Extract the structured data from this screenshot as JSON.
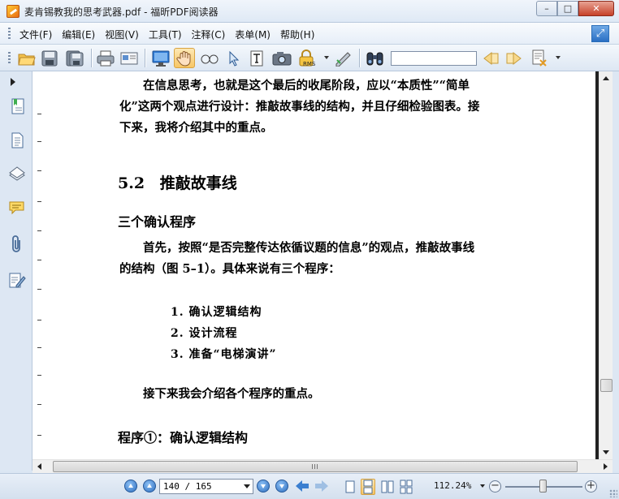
{
  "window": {
    "title": "麦肯锡教我的思考武器.pdf - 福昕PDF阅读器",
    "minimize_glyph": "–",
    "maximize_glyph": "□",
    "close_glyph": "✕"
  },
  "menu": {
    "items": [
      {
        "label": "文件(F)"
      },
      {
        "label": "编辑(E)"
      },
      {
        "label": "视图(V)"
      },
      {
        "label": "工具(T)"
      },
      {
        "label": "注释(C)"
      },
      {
        "label": "表单(M)"
      },
      {
        "label": "帮助(H)"
      }
    ]
  },
  "toolbar": {
    "search_value": "",
    "icons": [
      "open-folder-icon",
      "save-icon",
      "save-as-icon",
      "print-icon",
      "email-icon",
      "fullscreen-icon",
      "hand-tool-icon",
      "zoom-tool-icon",
      "select-arrow-icon",
      "text-select-icon",
      "snapshot-icon",
      "rms-lock-icon",
      "typewriter-icon",
      "binoculars-icon",
      "prev-result-icon",
      "next-result-icon",
      "highlight-icon"
    ],
    "rms_label": "RMS"
  },
  "document": {
    "para1": "在信息思考，也就是这个最后的收尾阶段，应以“本质性”“简单",
    "para1_line2": "化”这两个观点进行设计：推敲故事线的结构，并且仔细检验图表。接",
    "para1_line3": "下来，我将介绍其中的重点。",
    "section_number": "5.2",
    "section_title": "推敲故事线",
    "subheading1": "三个确认程序",
    "para2_line1": "首先，按照“是否完整传达依循议题的信息”的观点，推敲故事线",
    "para2_line2": "的结构（图 5–1）。具体来说有三个程序：",
    "list": [
      "1. 确认逻辑结构",
      "2. 设计流程",
      "3. 准备“电梯演讲”"
    ],
    "para3": "接下来我会介绍各个程序的重点。",
    "subheading2": "程序①：确认逻辑结构"
  },
  "statusbar": {
    "page_field": "140 / 165",
    "zoom": "112.24%",
    "zoom_out_glyph": "−",
    "zoom_in_glyph": "+"
  }
}
